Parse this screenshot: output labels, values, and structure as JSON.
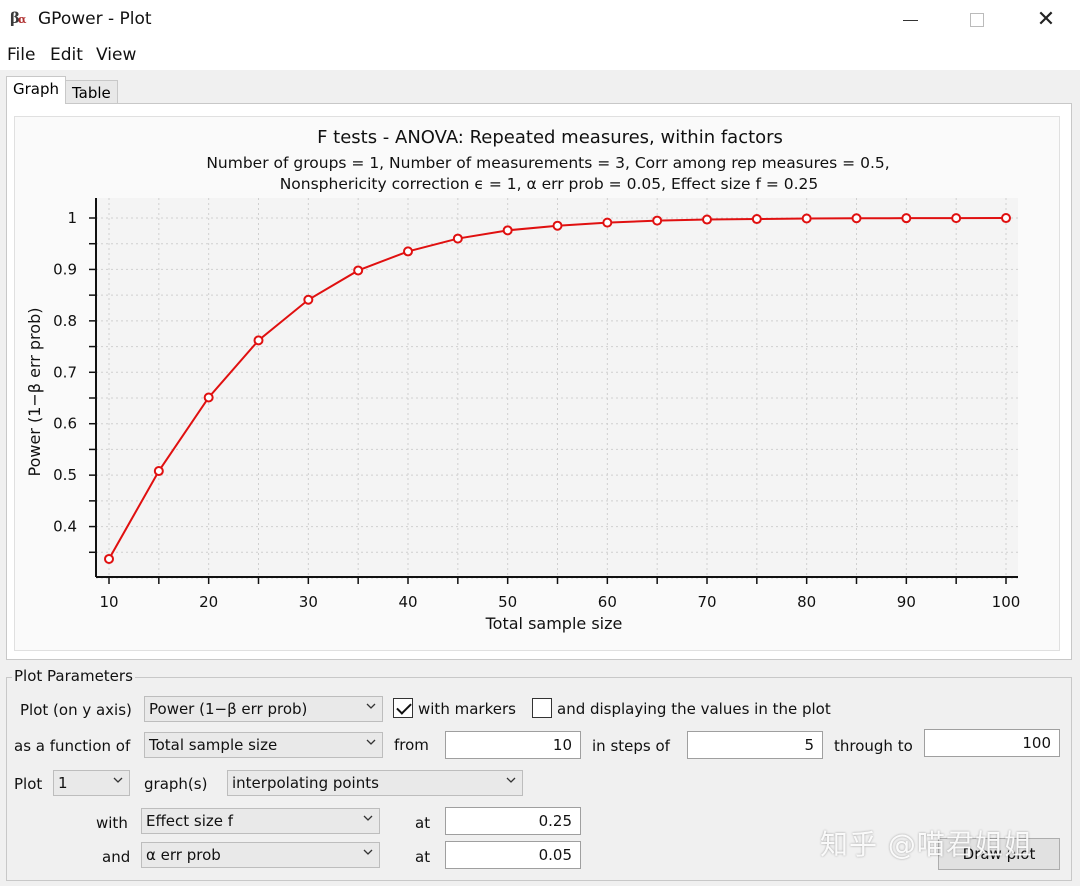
{
  "window": {
    "title": "GPower - Plot",
    "icon": "gpower-beta-alpha-icon"
  },
  "menu": [
    "File",
    "Edit",
    "View"
  ],
  "tabs": [
    {
      "label": "Graph",
      "active": true
    },
    {
      "label": "Table",
      "active": false
    }
  ],
  "chart_data": {
    "type": "line",
    "title": "F tests - ANOVA: Repeated measures, within factors",
    "subtitle_line1": "Number of groups = 1, Number of measurements = 3, Corr among rep measures = 0.5,",
    "subtitle_line2": "Nonsphericity correction ϵ = 1, α err prob = 0.05, Effect size f = 0.25",
    "xlabel": "Total sample size",
    "ylabel": "Power (1−β err prob)",
    "xlim": [
      10,
      100
    ],
    "ylim": [
      0.3,
      1.0
    ],
    "xticks": [
      10,
      20,
      30,
      40,
      50,
      60,
      70,
      80,
      90,
      100
    ],
    "yticks": [
      0.4,
      0.5,
      0.6,
      0.7,
      0.8,
      0.9,
      1
    ],
    "grid": true,
    "markers": true,
    "color": "#e01010",
    "x": [
      10,
      15,
      20,
      25,
      30,
      35,
      40,
      45,
      50,
      55,
      60,
      65,
      70,
      75,
      80,
      85,
      90,
      95,
      100
    ],
    "y": [
      0.337,
      0.508,
      0.651,
      0.762,
      0.841,
      0.898,
      0.935,
      0.96,
      0.976,
      0.985,
      0.991,
      0.995,
      0.997,
      0.998,
      0.999,
      0.9995,
      0.9997,
      0.9998,
      0.9999
    ]
  },
  "params": {
    "legend": "Plot Parameters",
    "plot_on_y_label": "Plot (on y axis)",
    "plot_on_y_value": "Power (1−β err prob)",
    "with_markers_label": "with markers",
    "with_markers_checked": true,
    "display_values_label": "and displaying the values in the plot",
    "display_values_checked": false,
    "function_of_label": "as a function of",
    "function_of_value": "Total sample size",
    "from_label": "from",
    "from_value": "10",
    "steps_label": "in steps of",
    "steps_value": "5",
    "through_label": "through to",
    "through_value": "100",
    "plot_label": "Plot",
    "plot_count": "1",
    "graphs_label": "graph(s)",
    "graph_mode": "interpolating points",
    "with_label": "with",
    "with_value": "Effect size f",
    "at1_label": "at",
    "at1_value": "0.25",
    "and_label": "and",
    "and_value": "α err prob",
    "at2_label": "at",
    "at2_value": "0.05",
    "draw_button": "Draw plot"
  },
  "watermark": "知乎 @喵君姐姐"
}
